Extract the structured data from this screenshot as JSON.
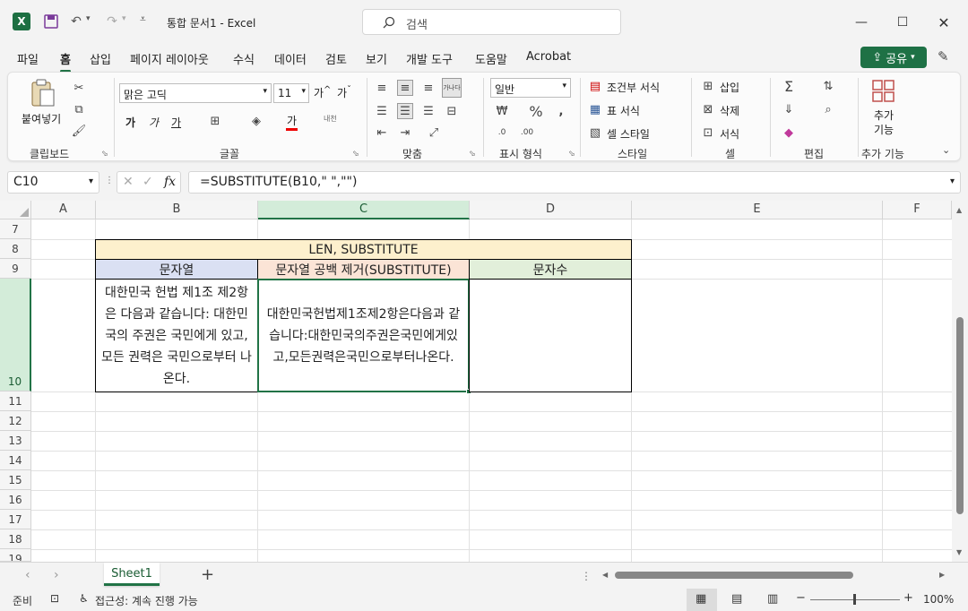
{
  "titlebar": {
    "doc_title": "통합 문서1  -  Excel",
    "search_placeholder": "검색"
  },
  "menu": {
    "tabs": [
      "파일",
      "홈",
      "삽입",
      "페이지 레이아웃",
      "수식",
      "데이터",
      "검토",
      "보기",
      "개발 도구",
      "도움말",
      "Acrobat"
    ],
    "active_tab": "홈",
    "share_label": "공유"
  },
  "ribbon": {
    "clipboard": {
      "paste_label": "붙여넣기",
      "group_label": "클립보드"
    },
    "font": {
      "font_name": "맑은 고딕",
      "font_size": "11",
      "group_label": "글꼴",
      "bold": "가",
      "italic": "가",
      "underline": "가",
      "font_color": "가"
    },
    "alignment": {
      "group_label": "맞춤",
      "wrap_label": "가나다"
    },
    "number": {
      "format": "일반",
      "group_label": "표시 형식"
    },
    "styles": {
      "conditional": "조건부 서식",
      "table": "표 서식",
      "cell": "셀 스타일",
      "group_label": "스타일"
    },
    "cells": {
      "insert": "삽입",
      "delete": "삭제",
      "format": "서식",
      "group_label": "셀"
    },
    "editing": {
      "group_label": "편집"
    },
    "addins": {
      "label": "추가 기능",
      "button": "추가\n기능"
    }
  },
  "formula_bar": {
    "name_box": "C10",
    "formula": "=SUBSTITUTE(B10,\" \",\"\")",
    "fx": "fx"
  },
  "grid": {
    "columns": [
      "A",
      "B",
      "C",
      "D",
      "E",
      "F"
    ],
    "selected_column": "C",
    "rows": [
      "7",
      "8",
      "9",
      "10",
      "11",
      "12",
      "13",
      "14",
      "15",
      "16",
      "17",
      "18",
      "19"
    ],
    "selected_row": "10",
    "table_title": "LEN, SUBSTITUTE",
    "headers": {
      "b": "문자열",
      "c": "문자열 공백 제거(SUBSTITUTE)",
      "d": "문자수"
    },
    "cell_b10": "대한민국 헌법 제1조 제2항은 다음과 같습니다: 대한민국의 주권은 국민에게 있고, 모든 권력은 국민으로부터 나온다.",
    "cell_c10": "대한민국헌법제1조제2항은다음과 같습니다:대한민국의주권은국민에게있고,모든권력은국민으로부터나온다.",
    "cell_d10": "",
    "colors": {
      "title_bg": "#fdf0cd",
      "b_header_bg": "#dae0f3",
      "c_header_bg": "#fbe4d6",
      "d_header_bg": "#e2efda",
      "select": "#217346"
    }
  },
  "sheets": {
    "active": "Sheet1"
  },
  "status": {
    "ready": "준비",
    "accessibility": "접근성: 계속 진행 가능",
    "zoom": "100%"
  },
  "brand_color": "#217346"
}
